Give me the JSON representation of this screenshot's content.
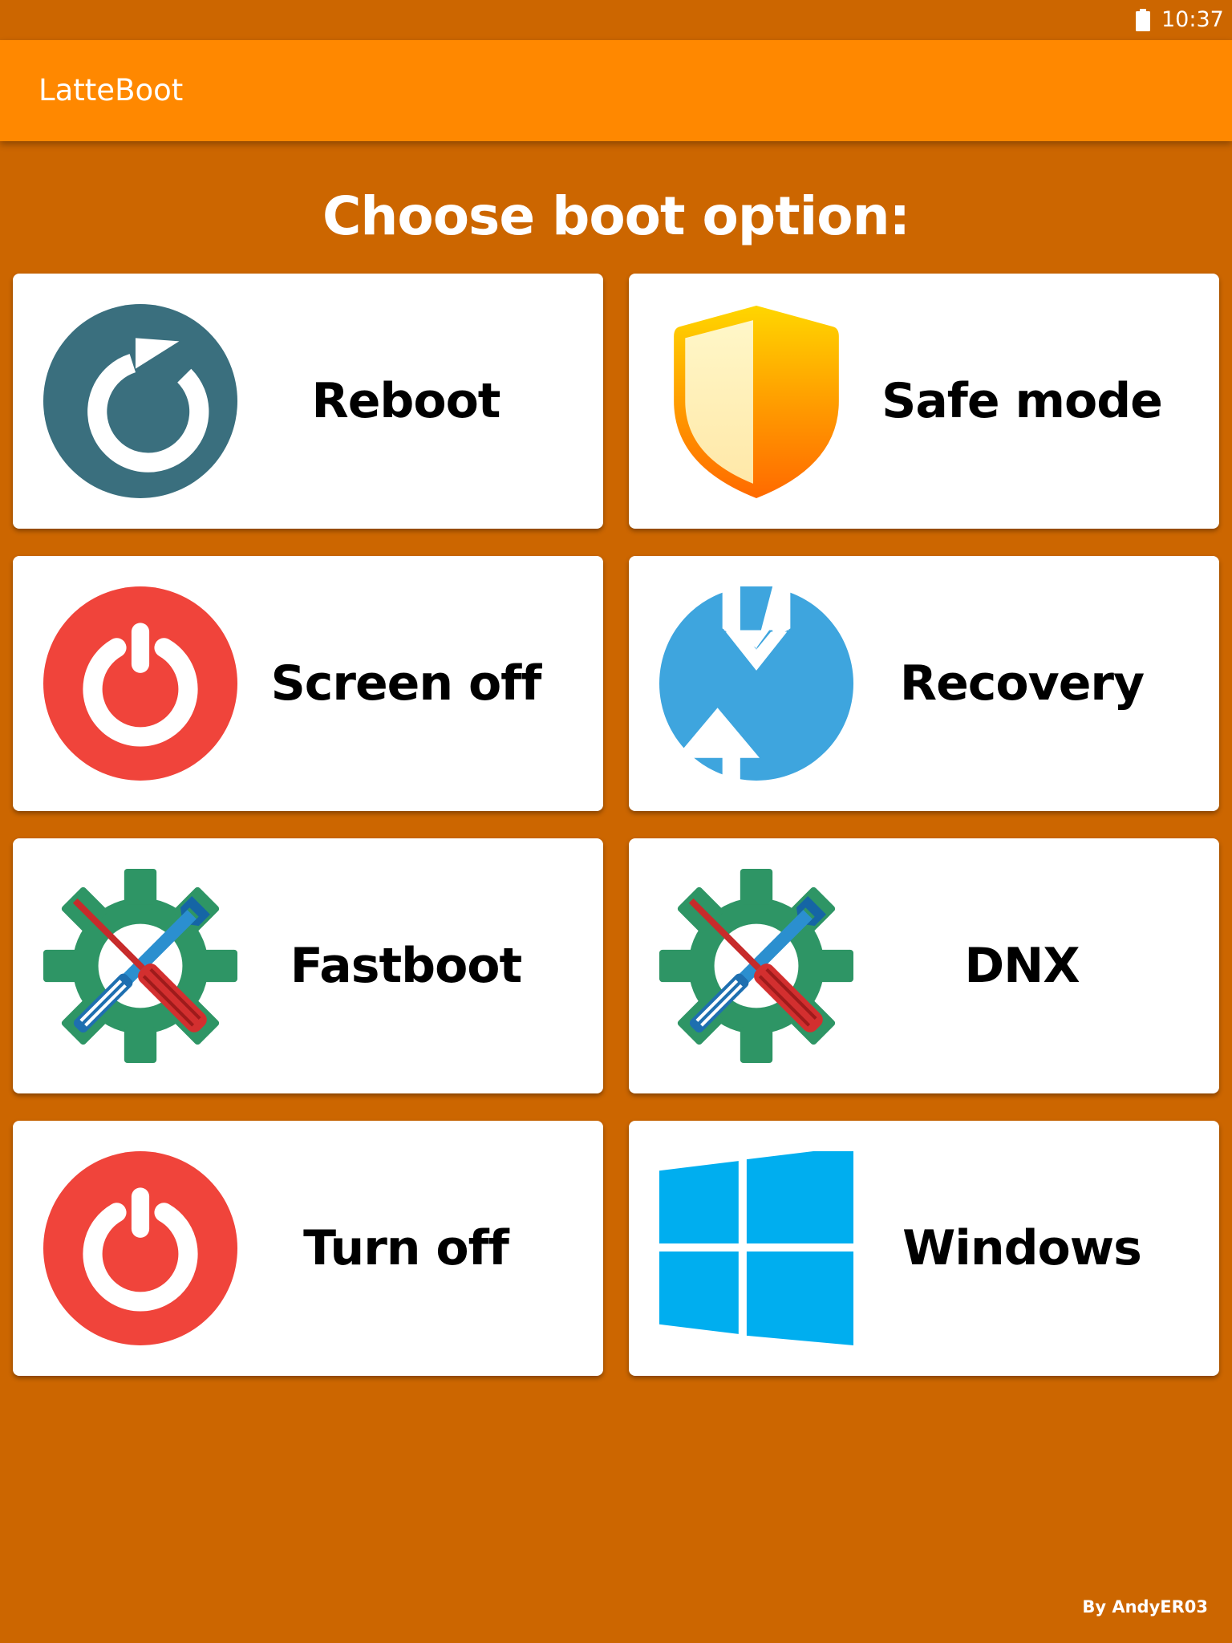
{
  "status_bar": {
    "time": "10:37",
    "battery_icon": "battery-full-icon"
  },
  "app_bar": {
    "title": "LatteBoot"
  },
  "heading": "Choose boot option:",
  "options": [
    {
      "label": "Reboot",
      "icon": "reboot-icon"
    },
    {
      "label": "Safe mode",
      "icon": "shield-icon"
    },
    {
      "label": "Screen off",
      "icon": "power-icon"
    },
    {
      "label": "Recovery",
      "icon": "recovery-icon"
    },
    {
      "label": "Fastboot",
      "icon": "tools-gear-icon"
    },
    {
      "label": "DNX",
      "icon": "tools-gear-icon"
    },
    {
      "label": "Turn off",
      "icon": "power-icon"
    },
    {
      "label": "Windows",
      "icon": "windows-logo-icon"
    }
  ],
  "footer": "By AndyER03",
  "colors": {
    "background": "#CC6600",
    "app_bar": "#FF8800",
    "card": "#FFFFFF",
    "reboot": "#3A6F7E",
    "power": "#F0443B",
    "recovery": "#3EA5DE",
    "windows": "#00AEEF",
    "gear": "#2E9565"
  }
}
